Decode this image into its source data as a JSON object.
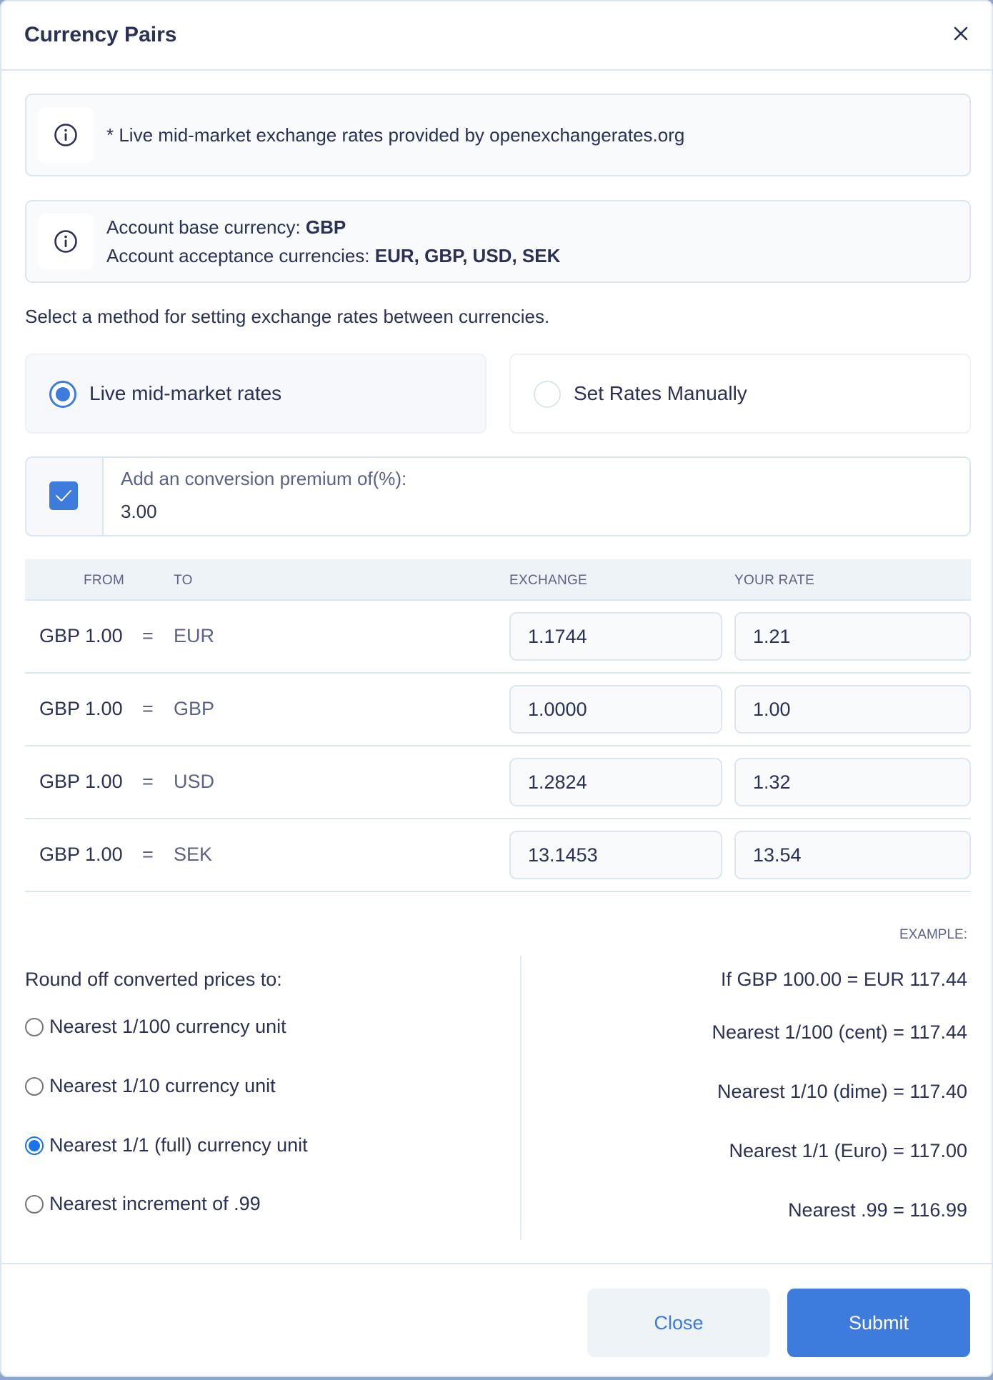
{
  "dialog": {
    "title": "Currency Pairs",
    "close_icon": "close-icon"
  },
  "info": {
    "provider_note": "* Live mid-market exchange rates provided by openexchangerates.org",
    "base_currency_label": "Account base currency: ",
    "base_currency_value": "GBP",
    "acceptance_label": "Account acceptance currencies: ",
    "acceptance_value": "EUR, GBP, USD, SEK",
    "icon": "info-icon"
  },
  "method": {
    "prompt": "Select a method for setting exchange rates between currencies.",
    "options": [
      {
        "label": "Live mid-market rates",
        "selected": true
      },
      {
        "label": "Set Rates Manually",
        "selected": false
      }
    ]
  },
  "premium": {
    "checked": true,
    "label": "Add an conversion premium of(%):",
    "value": "3.00"
  },
  "table": {
    "headers": {
      "from": "FROM",
      "to": "TO",
      "exchange": "EXCHANGE",
      "your_rate": "YOUR RATE"
    },
    "equals": "=",
    "rows": [
      {
        "from": "GBP 1.00",
        "to": "EUR",
        "exchange": "1.1744",
        "your_rate": "1.21"
      },
      {
        "from": "GBP 1.00",
        "to": "GBP",
        "exchange": "1.0000",
        "your_rate": "1.00"
      },
      {
        "from": "GBP 1.00",
        "to": "USD",
        "exchange": "1.2824",
        "your_rate": "1.32"
      },
      {
        "from": "GBP 1.00",
        "to": "SEK",
        "exchange": "13.1453",
        "your_rate": "13.54"
      }
    ]
  },
  "rounding": {
    "title": "Round off converted prices to:",
    "options": [
      {
        "label": "Nearest 1/100 currency unit",
        "selected": false
      },
      {
        "label": "Nearest 1/10 currency unit",
        "selected": false
      },
      {
        "label": "Nearest 1/1 (full) currency unit",
        "selected": true
      },
      {
        "label": "Nearest increment of .99",
        "selected": false
      }
    ]
  },
  "example": {
    "label": "EXAMPLE:",
    "lines": [
      "If GBP 100.00 = EUR 117.44",
      "Nearest 1/100 (cent) = 117.44",
      "Nearest 1/10 (dime) = 117.40",
      "Nearest 1/1 (Euro) = 117.00",
      "Nearest .99 = 116.99"
    ]
  },
  "footer": {
    "close_label": "Close",
    "submit_label": "Submit"
  },
  "colors": {
    "accent": "#3d7bdc",
    "text_primary": "#2b3154",
    "text_secondary": "#5b6287",
    "border": "#dce6f1"
  }
}
